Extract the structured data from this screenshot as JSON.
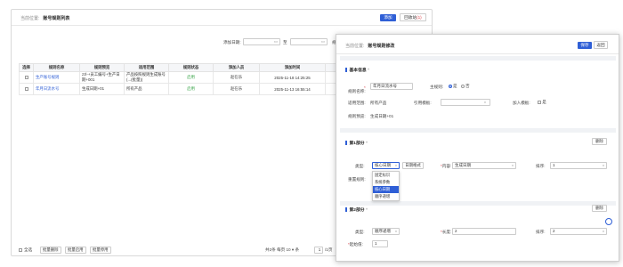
{
  "list_page": {
    "breadcrumb_prefix": "当前位置:",
    "breadcrumb_title": "账号规则列表",
    "add_button": "添加",
    "recycle_prefix": "回收站",
    "recycle_count": "(1)",
    "filter_label": "添加日期:",
    "filter_to": "至",
    "filter_name_label": "规则名称:",
    "columns": [
      "选择",
      "规则名称",
      "规则预览",
      "适用范围",
      "规则状态",
      "添加人员",
      "添加时间"
    ],
    "rows": [
      {
        "name": "生产账号规则",
        "preview": "zzl-+员工编号+生产日期+001",
        "scope": "产品按照规则生成账号(...(批量))",
        "status": "启用",
        "user": "赵在乐",
        "time": "2025-11-18 14:25:25"
      },
      {
        "name": "年月日流水号",
        "preview": "生成日期+01",
        "scope": "所有产品",
        "status": "启用",
        "user": "赵在乐",
        "time": "2025-11-13 16:55:14"
      }
    ],
    "footer": {
      "select_all": "全选",
      "batch_delete": "批量删除",
      "batch_enable": "批量启用",
      "batch_disable": "批量停用",
      "pager_text": "共2条  每页 10 ▾ 条",
      "page_input": "1",
      "page_total": "/1页"
    }
  },
  "edit_dialog": {
    "breadcrumb_prefix": "当前位置:",
    "breadcrumb_title": "账号规则修改",
    "save_button": "保存",
    "back_button": "返回",
    "basic_section": {
      "title": "基本信息",
      "collapse_icon": "chevron-up-icon",
      "rule_name_label": "规则名称:",
      "rule_name_value": "年月日流水号",
      "main_rule_label": "主规则:",
      "main_rule_yes": "是",
      "main_rule_no": "否",
      "scope_label": "适用范围:",
      "scope_value": "所有产品",
      "template_label": "引用模板:",
      "template_value": "",
      "join_template_label": "加入模板:",
      "join_template_option": "是",
      "preview_label": "规则预览:",
      "preview_value": "生成日期+01"
    },
    "part1": {
      "title": "第1部分",
      "delete_button": "删除",
      "type_label": "类型:",
      "type_value": "核心日期",
      "date_format_button": "日期格式",
      "content_label": "内容:",
      "content_value": "生成日期",
      "order_label": "排序:",
      "order_value": "1",
      "reset_rule_label": "重置规则:",
      "dropdown_options": [
        "固定标识",
        "系统参数",
        "核心日期",
        "顺序递增"
      ],
      "dropdown_selected": "核心日期"
    },
    "part2": {
      "title": "第2部分",
      "delete_button": "删除",
      "type_label": "类型:",
      "type_value": "顺序递增",
      "length_label": "长度:",
      "length_value": "2",
      "order_label": "排序:",
      "order_value": "2",
      "start_label": "起始值:",
      "start_value": "1"
    }
  },
  "colors": {
    "accent": "#2f5fd6",
    "enabled_status": "#2a9d3a",
    "danger": "#d9363e"
  }
}
